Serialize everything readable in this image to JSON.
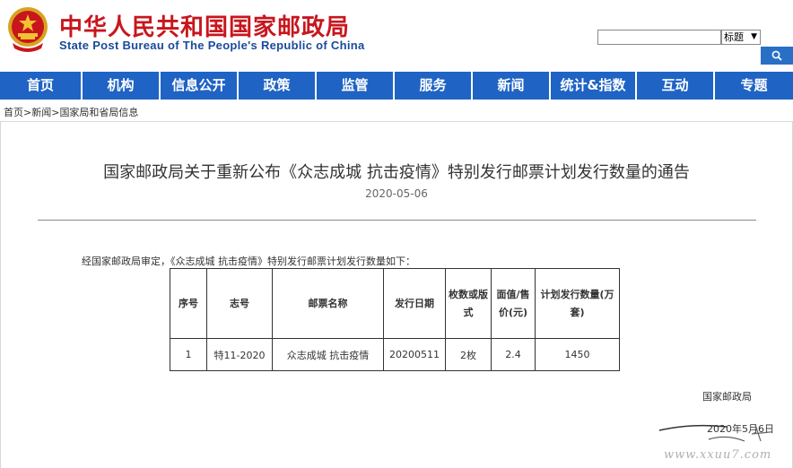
{
  "header": {
    "title_cn": "中华人民共和国国家邮政局",
    "title_en": "State Post Bureau of The People's Republic of China",
    "search": {
      "value": "",
      "select_value": "标题"
    }
  },
  "nav": {
    "items": [
      {
        "label": "首页"
      },
      {
        "label": "机构"
      },
      {
        "label": "信息公开"
      },
      {
        "label": "政策"
      },
      {
        "label": "监管"
      },
      {
        "label": "服务"
      },
      {
        "label": "新闻"
      },
      {
        "label": "统计&指数"
      },
      {
        "label": "互动"
      },
      {
        "label": "专题"
      }
    ]
  },
  "breadcrumb": {
    "items": [
      "首页",
      "新闻",
      "国家局和省局信息"
    ],
    "separator": ">"
  },
  "article": {
    "title": "国家邮政局关于重新公布《众志成城 抗击疫情》特别发行邮票计划发行数量的通告",
    "date": "2020-05-06",
    "intro": "经国家邮政局审定，《众志成城 抗击疫情》特别发行邮票计划发行数量如下：",
    "table": {
      "headers": [
        "序号",
        "志号",
        "邮票名称",
        "发行日期",
        "枚数或版式",
        "面值/售价(元)",
        "计划发行数量(万套)"
      ],
      "rows": [
        [
          "1",
          "特11-2020",
          "众志成城 抗击疫情",
          "20200511",
          "2枚",
          "2.4",
          "1450"
        ]
      ]
    },
    "signer": "国家邮政局",
    "sign_date": "2020年5月6日"
  },
  "watermark": {
    "text": "www.xxuu7.com"
  },
  "colors": {
    "nav_bg": "#1f63c4",
    "title_red": "#c8161d",
    "en_blue": "#1a4a9a"
  }
}
